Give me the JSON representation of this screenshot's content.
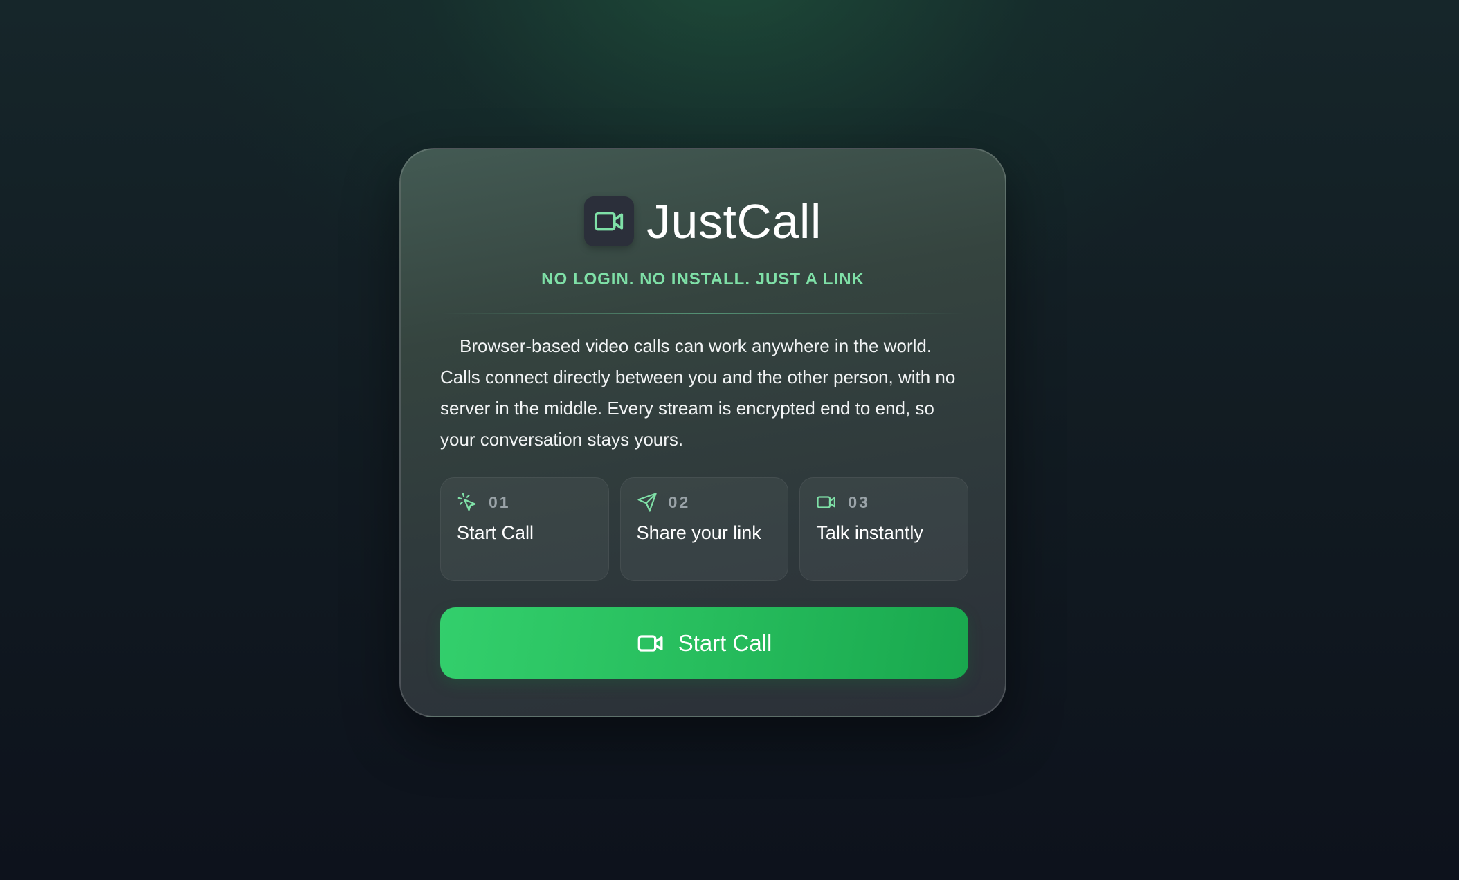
{
  "app": {
    "name": "JustCall",
    "logo_icon": "video-camera-icon",
    "tagline": "NO LOGIN. NO INSTALL. JUST A LINK"
  },
  "description": "Browser-based video calls can work anywhere in the world. Calls connect directly between you and the other person, with no server in the middle. Every stream is encrypted end to end, so your conversation stays yours.",
  "steps": [
    {
      "number": "01",
      "label": "Start Call",
      "icon": "click-cursor-icon"
    },
    {
      "number": "02",
      "label": "Share your link",
      "icon": "send-paper-plane-icon"
    },
    {
      "number": "03",
      "label": "Talk instantly",
      "icon": "video-camera-icon"
    }
  ],
  "cta": {
    "label": "Start Call",
    "icon": "video-camera-icon"
  },
  "colors": {
    "accent": "#7fe0a7",
    "button_start": "#33cf6c",
    "button_end": "#19a84e",
    "card_bg": "#35443f",
    "page_bg": "#0d121c"
  }
}
